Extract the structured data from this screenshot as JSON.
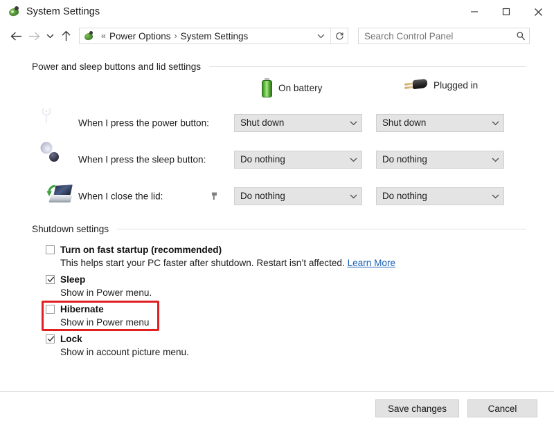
{
  "window": {
    "title": "System Settings",
    "icon": "control-panel-icon",
    "controls": {
      "minimize": "minimize-icon",
      "maximize": "maximize-icon",
      "close": "close-icon"
    }
  },
  "addressbar": {
    "back": "back-arrow-icon",
    "forward": "forward-arrow-icon",
    "recent": "chevron-down-icon",
    "up": "up-arrow-icon",
    "breadcrumb": {
      "separator_leading": "«",
      "items": [
        "Power Options",
        "System Settings"
      ],
      "separator": "›"
    },
    "dropdown": "chevron-down-icon",
    "refresh": "refresh-icon",
    "search": {
      "placeholder": "Search Control Panel",
      "icon": "search-icon"
    }
  },
  "main": {
    "section_power": {
      "title": "Power and sleep buttons and lid settings",
      "columns": [
        {
          "label": "On battery",
          "icon": "battery-icon"
        },
        {
          "label": "Plugged in",
          "icon": "power-plug-icon"
        }
      ],
      "rows": [
        {
          "icon": "power-button-icon",
          "label": "When I press the power button:",
          "on_battery": "Shut down",
          "plugged_in": "Shut down"
        },
        {
          "icon": "sleep-moon-icon",
          "label": "When I press the sleep button:",
          "on_battery": "Do nothing",
          "plugged_in": "Do nothing"
        },
        {
          "icon": "laptop-lid-icon",
          "label": "When I close the lid:",
          "on_battery": "Do nothing",
          "plugged_in": "Do nothing"
        }
      ]
    },
    "section_shutdown": {
      "title": "Shutdown settings",
      "options": [
        {
          "label": "Turn on fast startup (recommended)",
          "checked": false,
          "description": "This helps start your PC faster after shutdown. Restart isn’t affected.",
          "link": "Learn More",
          "highlighted": false
        },
        {
          "label": "Sleep",
          "checked": true,
          "description": "Show in Power menu.",
          "link": "",
          "highlighted": false
        },
        {
          "label": "Hibernate",
          "checked": false,
          "description": "Show in Power menu",
          "link": "",
          "highlighted": true
        },
        {
          "label": "Lock",
          "checked": true,
          "description": "Show in account picture menu.",
          "link": "",
          "highlighted": false
        }
      ]
    }
  },
  "footer": {
    "save": "Save changes",
    "cancel": "Cancel"
  },
  "colors": {
    "highlight": "#e02020",
    "link": "#1a5fb4",
    "battery_green": "#6dc64a",
    "dropdown_bg": "#e4e4e4"
  }
}
